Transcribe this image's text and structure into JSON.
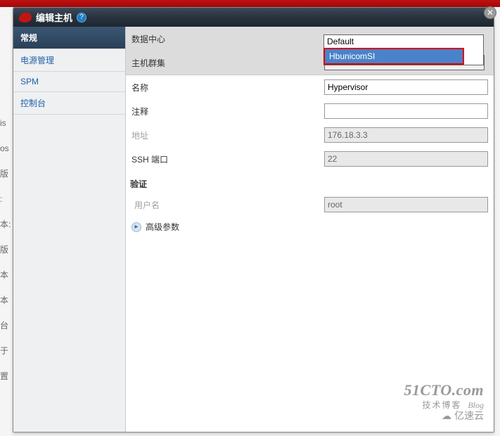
{
  "dialog": {
    "title": "编辑主机",
    "close": "✕"
  },
  "sidebar": {
    "items": [
      {
        "label": "常规",
        "active": true
      },
      {
        "label": "电源管理"
      },
      {
        "label": "SPM"
      },
      {
        "label": "控制台"
      }
    ]
  },
  "dropdown": {
    "default_option": "Default",
    "selected_option": "HbunicomSI"
  },
  "form": {
    "datacenter": {
      "label": "数据中心"
    },
    "cluster": {
      "label": "主机群集",
      "value": "HbunicomSI"
    },
    "name": {
      "label": "名称",
      "value": "Hypervisor"
    },
    "comment": {
      "label": "注释",
      "value": ""
    },
    "address": {
      "label": "地址",
      "value": "176.18.3.3"
    },
    "ssh_port": {
      "label": "SSH 端口",
      "value": "22"
    }
  },
  "auth": {
    "section": "验证",
    "username_label": "用户名",
    "username_value": "root",
    "advanced": "高级参数"
  },
  "watermark": {
    "main": "51CTO.com",
    "sub_cn": "技术博客",
    "sub_en": "Blog",
    "cloud": "亿速云"
  }
}
